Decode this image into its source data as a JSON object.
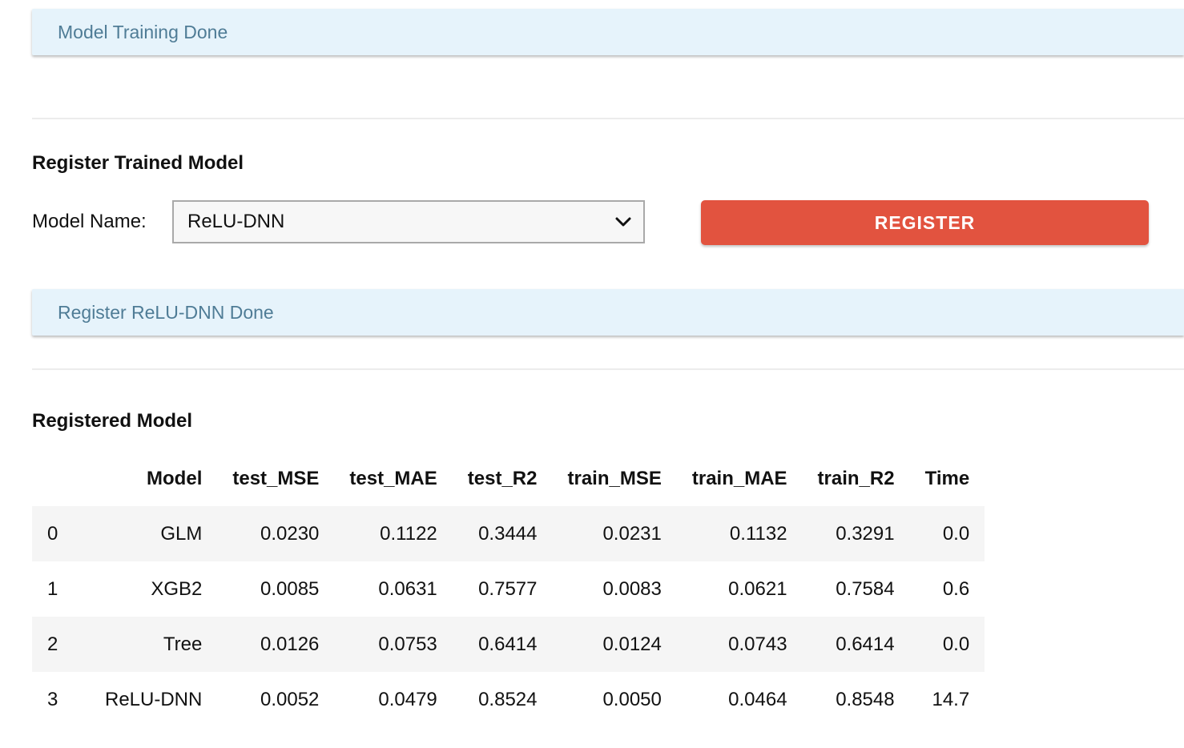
{
  "alerts": {
    "training_done": "Model Training Done",
    "register_done": "Register ReLU-DNN Done"
  },
  "register_section": {
    "title": "Register Trained Model",
    "model_name_label": "Model Name:",
    "selected_model": "ReLU-DNN",
    "register_button": "REGISTER"
  },
  "registered_section": {
    "title": "Registered Model",
    "columns": [
      "",
      "Model",
      "test_MSE",
      "test_MAE",
      "test_R2",
      "train_MSE",
      "train_MAE",
      "train_R2",
      "Time"
    ],
    "rows": [
      [
        "0",
        "GLM",
        "0.0230",
        "0.1122",
        "0.3444",
        "0.0231",
        "0.1132",
        "0.3291",
        "0.0"
      ],
      [
        "1",
        "XGB2",
        "0.0085",
        "0.0631",
        "0.7577",
        "0.0083",
        "0.0621",
        "0.7584",
        "0.6"
      ],
      [
        "2",
        "Tree",
        "0.0126",
        "0.0753",
        "0.6414",
        "0.0124",
        "0.0743",
        "0.6414",
        "0.0"
      ],
      [
        "3",
        "ReLU-DNN",
        "0.0052",
        "0.0479",
        "0.8524",
        "0.0050",
        "0.0464",
        "0.8548",
        "14.7"
      ]
    ]
  },
  "icons": {
    "select_caret": "chevron-down-icon"
  },
  "colors": {
    "alert_bg": "#e6f3fb",
    "alert_text": "#4f7c96",
    "register_button": "#e2533f",
    "stripe": "#f5f5f5"
  }
}
